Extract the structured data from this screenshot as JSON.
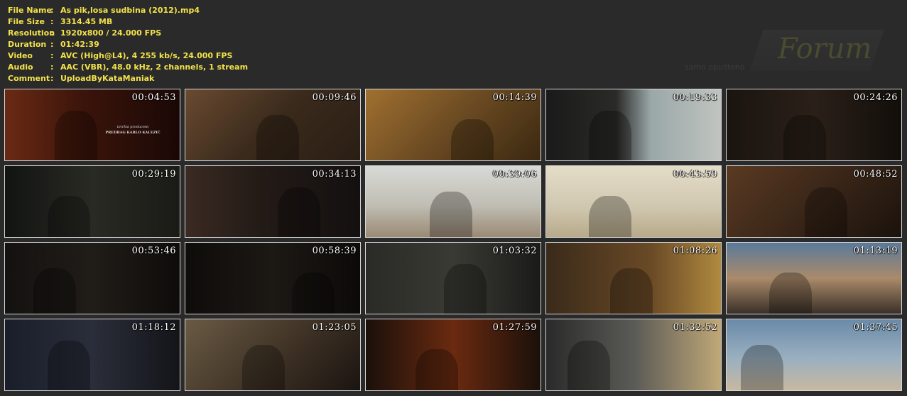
{
  "info": {
    "rows": [
      {
        "label": "File Name",
        "sep": ":",
        "value": "As pik,losa sudbina (2012).mp4"
      },
      {
        "label": "File Size",
        "sep": ":",
        "value": "3314.45 MB"
      },
      {
        "label": "Resolution",
        "sep": ":",
        "value": "1920x800 / 24.000 FPS"
      },
      {
        "label": "Duration",
        "sep": ":",
        "value": "01:42:39"
      },
      {
        "label": "Video",
        "sep": ":",
        "value": "AVC (High@L4), 4 255 kb/s, 24.000 FPS"
      },
      {
        "label": "Audio",
        "sep": ":",
        "value": "AAC (VBR), 48.0 kHz, 2 channels, 1 stream"
      },
      {
        "label": "Comment",
        "sep": ":",
        "value": "UploadByKataManiak"
      }
    ]
  },
  "watermark": {
    "title": "Forum",
    "subtitle": "samo opuśteno"
  },
  "credit": {
    "line1": "izvršni producent",
    "line2": "PREDRAG KARLO KALEZIĆ"
  },
  "thumbnails": [
    {
      "time": "00:04:53",
      "bg": "linear-gradient(90deg,#6a2a14 0%,#3a140a 45%,#1a0806 100%)"
    },
    {
      "time": "00:09:46",
      "bg": "linear-gradient(135deg,#6a4a30 0%,#3a2a1c 50%,#2a1e14 100%)"
    },
    {
      "time": "00:14:39",
      "bg": "linear-gradient(135deg,#a07030 0%,#6a4a22 50%,#3a2810 100%)"
    },
    {
      "time": "00:19:33",
      "bg": "linear-gradient(90deg,#1a1a1a 0%,#2a2a28 40%,#9aa8a8 60%,#c0c4c0 100%)"
    },
    {
      "time": "00:24:26",
      "bg": "linear-gradient(90deg,#1a1410 0%,#2a2018 50%,#120e0a 100%)"
    },
    {
      "time": "00:29:19",
      "bg": "linear-gradient(90deg,#121412 0%,#2a2a24 50%,#1a1a16 100%)"
    },
    {
      "time": "00:34:13",
      "bg": "linear-gradient(90deg,#3a2a22 0%,#221a16 45%,#141010 100%)"
    },
    {
      "time": "00:39:06",
      "bg": "linear-gradient(180deg,#d8dad6 0%,#c0beb4 55%,#9a8a74 100%)"
    },
    {
      "time": "00:43:59",
      "bg": "linear-gradient(180deg,#e4ddc8 0%,#cfc6ae 60%,#b8aa8a 100%)"
    },
    {
      "time": "00:48:52",
      "bg": "linear-gradient(135deg,#5a3a22 0%,#3a2618 50%,#1a120c 100%)"
    },
    {
      "time": "00:53:46",
      "bg": "linear-gradient(90deg,#141210 0%,#201c18 50%,#0e0c0a 100%)"
    },
    {
      "time": "00:58:39",
      "bg": "linear-gradient(90deg,#0e0c0a 0%,#1c1814 50%,#0c0a08 100%)"
    },
    {
      "time": "01:03:32",
      "bg": "linear-gradient(90deg,#2a2a26 0%,#3a3a34 50%,#1a1a18 100%)"
    },
    {
      "time": "01:08:26",
      "bg": "linear-gradient(90deg,#3a2a1a 0%,#6a4a26 60%,#b08a40 100%)"
    },
    {
      "time": "01:13:19",
      "bg": "linear-gradient(180deg,#5a7a9a 0%,#aa8a6a 50%,#3a3028 100%)"
    },
    {
      "time": "01:18:12",
      "bg": "linear-gradient(90deg,#1a1e2a 0%,#2a2e3a 50%,#141418 100%)"
    },
    {
      "time": "01:23:05",
      "bg": "linear-gradient(135deg,#6a5a44 0%,#3a2e22 60%,#1a1410 100%)"
    },
    {
      "time": "01:27:59",
      "bg": "linear-gradient(90deg,#1a100a 0%,#6a2a10 50%,#1a100a 100%)"
    },
    {
      "time": "01:32:52",
      "bg": "linear-gradient(90deg,#2a2a2a 0%,#5a5a56 50%,#c0a878 100%)"
    },
    {
      "time": "01:37:45",
      "bg": "linear-gradient(180deg,#6a8aa8 0%,#9ab0c0 55%,#c8b8a0 100%)"
    }
  ]
}
